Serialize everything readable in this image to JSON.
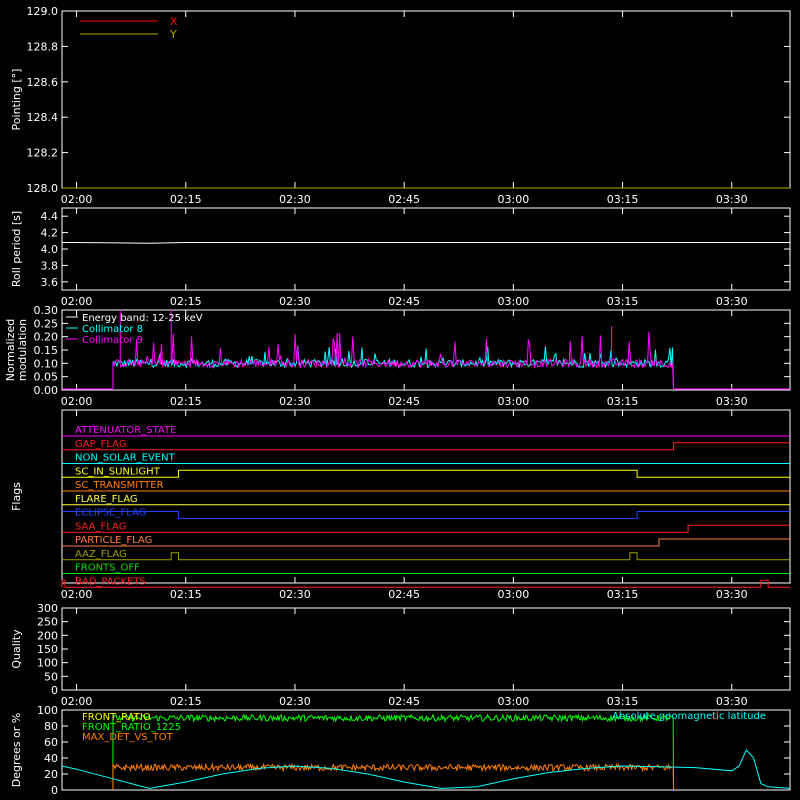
{
  "chart_data": [
    {
      "type": "line",
      "ylabel": "Pointing [°]",
      "ylim": [
        128.0,
        129.0
      ],
      "yticks": [
        "128.0",
        "128.2",
        "128.4",
        "128.6",
        "128.8",
        "129.0"
      ],
      "xticks": [
        "02:00",
        "02:15",
        "02:30",
        "02:45",
        "03:00",
        "03:15",
        "03:30"
      ],
      "legend": [
        {
          "name": "X",
          "color": "#ff0000"
        },
        {
          "name": "Y",
          "color": "#b0b000"
        }
      ],
      "series": [
        {
          "name": "X",
          "color": "#ff0000",
          "values": []
        },
        {
          "name": "Y",
          "color": "#b0b000",
          "values": []
        }
      ]
    },
    {
      "type": "line",
      "ylabel": "Roll period [s]",
      "ylim": [
        3.5,
        4.5
      ],
      "yticks": [
        "3.6",
        "3.8",
        "4.0",
        "4.2",
        "4.4"
      ],
      "xticks": [
        "02:00",
        "02:15",
        "02:30",
        "02:45",
        "03:00",
        "03:15",
        "03:30"
      ],
      "series": [
        {
          "name": "roll",
          "color": "#ffffff",
          "x": [
            "01:58",
            "02:00",
            "02:10",
            "02:15",
            "02:30",
            "02:45",
            "03:00",
            "03:15",
            "03:30",
            "03:38"
          ],
          "values": [
            4.08,
            4.08,
            4.07,
            4.08,
            4.08,
            4.08,
            4.08,
            4.08,
            4.08,
            4.08
          ]
        }
      ]
    },
    {
      "type": "line",
      "ylabel": "Normalized modulation",
      "ylim": [
        0.0,
        0.3
      ],
      "yticks": [
        "0.00",
        "0.05",
        "0.10",
        "0.15",
        "0.20",
        "0.25",
        "0.30"
      ],
      "xticks": [
        "02:00",
        "02:15",
        "02:30",
        "02:45",
        "03:00",
        "03:15",
        "03:30"
      ],
      "legend": [
        {
          "name": "Energy band: 12-25 keV",
          "color": "#ffffff"
        },
        {
          "name": "Collimator 8",
          "color": "#00ffff"
        },
        {
          "name": "Collimator 9",
          "color": "#ff00ff"
        }
      ],
      "series": [
        {
          "name": "Collimator 8",
          "color": "#00ffff",
          "active_range": [
            "02:05",
            "03:22"
          ],
          "baseline": 0.1,
          "spike_max": 0.21
        },
        {
          "name": "Collimator 9",
          "color": "#ff00ff",
          "active_range": [
            "02:05",
            "03:22"
          ],
          "baseline": 0.1,
          "spike_max": 0.3
        }
      ]
    },
    {
      "type": "line",
      "ylabel": "Flags",
      "xticks": [
        "02:00",
        "02:15",
        "02:30",
        "02:45",
        "03:00",
        "03:15",
        "03:30"
      ],
      "flags": [
        {
          "name": "ATTENUATOR_STATE",
          "color": "#ff00ff",
          "steps": []
        },
        {
          "name": "GAP_FLAG",
          "color": "#ff2020",
          "steps": [
            [
              "03:22",
              1
            ]
          ]
        },
        {
          "name": "NON_SOLAR_EVENT",
          "color": "#00ffff",
          "steps": []
        },
        {
          "name": "SC_IN_SUNLIGHT",
          "color": "#ffff00",
          "steps": [
            [
              "02:14",
              1
            ],
            [
              "03:17",
              0
            ]
          ]
        },
        {
          "name": "SC_TRANSMITTER",
          "color": "#ff8000",
          "steps": []
        },
        {
          "name": "FLARE_FLAG",
          "color": "#ffff40",
          "steps": []
        },
        {
          "name": "ECLIPSE_FLAG",
          "color": "#2040ff",
          "start": 1,
          "steps": [
            [
              "02:14",
              0
            ],
            [
              "03:17",
              1
            ]
          ]
        },
        {
          "name": "SAA_FLAG",
          "color": "#ff2020",
          "steps": [
            [
              "03:24",
              1
            ]
          ]
        },
        {
          "name": "PARTICLE_FLAG",
          "color": "#ff8040",
          "steps": [
            [
              "03:20",
              1
            ]
          ]
        },
        {
          "name": "AAZ_FLAG",
          "color": "#a0a000",
          "pulses": [
            [
              "02:13",
              "02:14"
            ],
            [
              "03:16",
              "03:17"
            ]
          ]
        },
        {
          "name": "FRONTS_OFF",
          "color": "#00e000",
          "steps": []
        },
        {
          "name": "BAD_PACKETS",
          "color": "#ff2020",
          "pulses": [
            [
              "01:58",
              "01:58"
            ],
            [
              "03:34",
              "03:35"
            ]
          ]
        }
      ]
    },
    {
      "type": "line",
      "ylabel": "Quality",
      "ylim": [
        0,
        300
      ],
      "yticks": [
        "0",
        "50",
        "100",
        "150",
        "200",
        "250",
        "300"
      ],
      "xticks": [
        "02:00",
        "02:15",
        "02:30",
        "02:45",
        "03:00",
        "03:15",
        "03:30"
      ],
      "series": []
    },
    {
      "type": "line",
      "ylabel": "Degrees or %",
      "ylim": [
        0,
        100
      ],
      "yticks": [
        "0",
        "20",
        "40",
        "60",
        "80",
        "100"
      ],
      "legend": [
        {
          "name": "FRONT_RATIO",
          "color": "#ffff00"
        },
        {
          "name": "FRONT_RATIO_1225",
          "color": "#00ff00"
        },
        {
          "name": "MAX_DET_VS_TOT",
          "color": "#ff8000"
        }
      ],
      "right_label": {
        "name": "Absolute geomagnetic latitude",
        "color": "#00ffff"
      },
      "series": [
        {
          "name": "FRONT_RATIO_1225",
          "color": "#00ff00",
          "active_range": [
            "02:05",
            "03:22"
          ],
          "baseline": 90
        },
        {
          "name": "MAX_DET_VS_TOT",
          "color": "#ff8000",
          "active_range": [
            "02:05",
            "03:22"
          ],
          "baseline": 28
        },
        {
          "name": "Absolute geomagnetic latitude",
          "color": "#00ffff",
          "x": [
            "01:58",
            "02:00",
            "02:05",
            "02:10",
            "02:15",
            "02:20",
            "02:25",
            "02:30",
            "02:35",
            "02:40",
            "02:45",
            "02:50",
            "02:55",
            "03:00",
            "03:05",
            "03:10",
            "03:15",
            "03:20",
            "03:25",
            "03:30",
            "03:31",
            "03:32",
            "03:33",
            "03:34",
            "03:35",
            "03:38"
          ],
          "values": [
            30,
            26,
            14,
            2,
            10,
            20,
            27,
            30,
            27,
            20,
            10,
            2,
            4,
            14,
            22,
            27,
            30,
            29,
            28,
            24,
            30,
            50,
            40,
            8,
            4,
            2
          ]
        }
      ]
    }
  ]
}
